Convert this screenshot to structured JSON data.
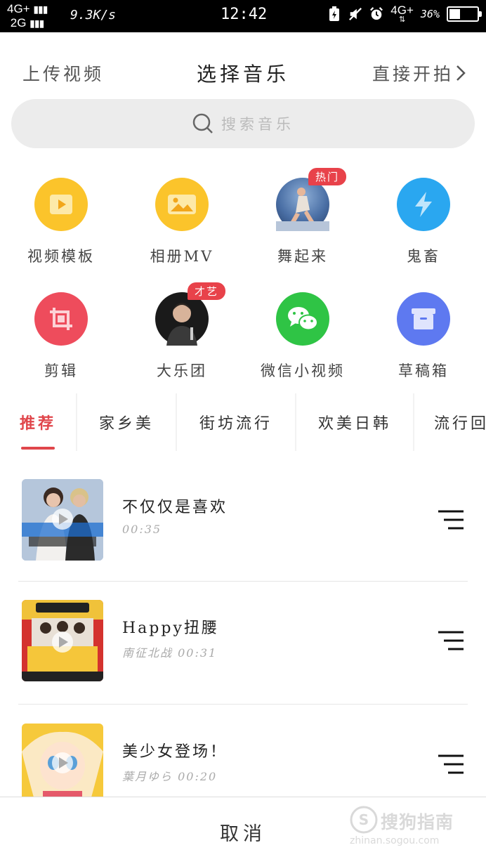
{
  "status_bar": {
    "network_top": "4G+",
    "network_bottom": "2G",
    "speed": "9.3K/s",
    "time": "12:42",
    "network_right": "4G+",
    "battery_percent": "36%",
    "battery_level": 0.36
  },
  "header": {
    "left": "上传视频",
    "title": "选择音乐",
    "right": "直接开拍"
  },
  "search": {
    "placeholder": "搜索音乐"
  },
  "features": [
    {
      "label": "视频模板",
      "icon": "video-template-icon",
      "color": "#fbc42b"
    },
    {
      "label": "相册MV",
      "icon": "photo-album-icon",
      "color": "#fbc42b"
    },
    {
      "label": "舞起来",
      "icon": "dancer-avatar",
      "color": "#4a6fa5",
      "badge": "热门"
    },
    {
      "label": "鬼畜",
      "icon": "lightning-icon",
      "color": "#2aa7f0"
    },
    {
      "label": "剪辑",
      "icon": "crop-icon",
      "color": "#ee4c5c"
    },
    {
      "label": "大乐团",
      "icon": "singer-avatar",
      "color": "#1a1a1a",
      "badge": "才艺"
    },
    {
      "label": "微信小视频",
      "icon": "wechat-icon",
      "color": "#2fc445"
    },
    {
      "label": "草稿箱",
      "icon": "draft-box-icon",
      "color": "#5e79f0"
    }
  ],
  "tabs": [
    "推荐",
    "家乡美",
    "街坊流行",
    "欢美日韩",
    "流行回"
  ],
  "songs": [
    {
      "title": "不仅仅是喜欢",
      "subtitle": "00:35",
      "cover_text": "不仅仅是喜欢",
      "cover_names": "萧全 孙语赛"
    },
    {
      "title": "Happy扭腰",
      "subtitle": "南征北战  00:31",
      "cover_text": "扭腰",
      "cover_year": "2018 大年初一"
    },
    {
      "title": "美少女登场！",
      "subtitle": "葉月ゆら  00:20"
    }
  ],
  "bottom": {
    "cancel": "取消",
    "watermark_brand": "搜狗指南",
    "watermark_url": "zhinan.sogou.com"
  }
}
